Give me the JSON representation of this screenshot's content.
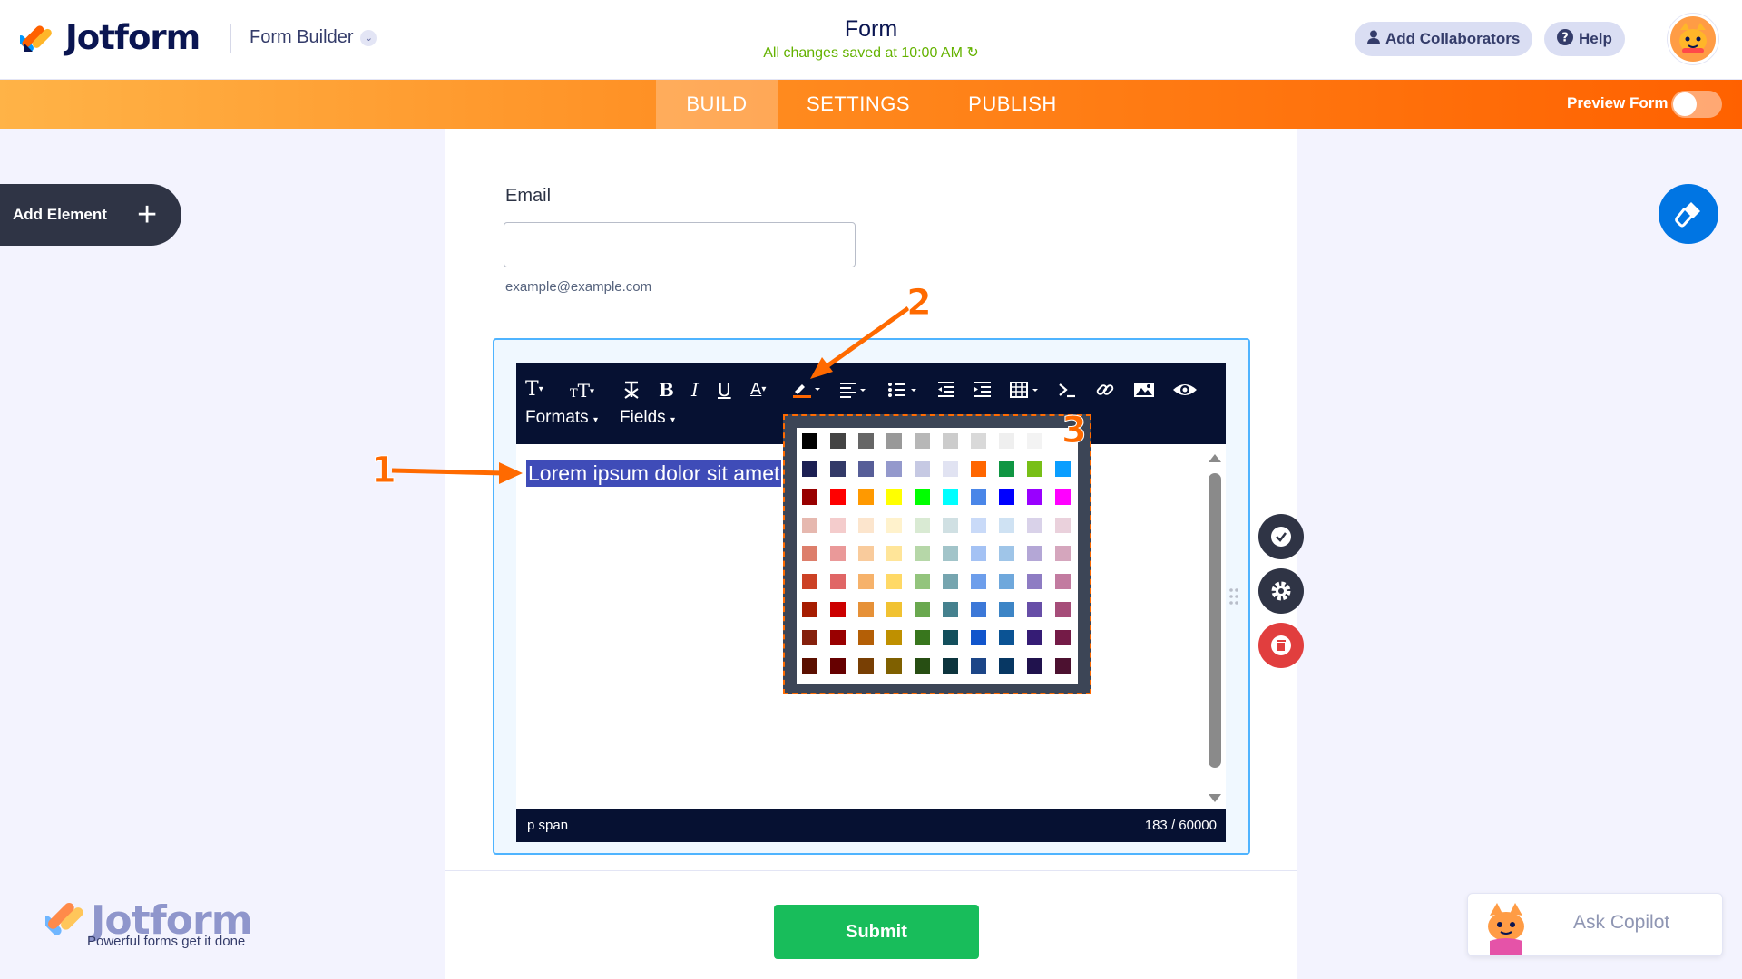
{
  "header": {
    "logo_text": "Jotform",
    "builder_label": "Form Builder",
    "form_title": "Form",
    "saved_status": "All changes saved at 10:00 AM",
    "collaborators_label": "Add Collaborators",
    "help_label": "Help"
  },
  "nav": {
    "tabs": [
      {
        "label": "BUILD",
        "active": true
      },
      {
        "label": "SETTINGS",
        "active": false
      },
      {
        "label": "PUBLISH",
        "active": false
      }
    ],
    "preview_label": "Preview Form",
    "preview_on": false
  },
  "sidebar": {
    "add_element_label": "Add Element"
  },
  "form": {
    "email_label": "Email",
    "email_value": "",
    "email_sublabel": "example@example.com",
    "editor": {
      "toolbar": {
        "formats_label": "Formats",
        "fields_label": "Fields"
      },
      "selected_text": "Lorem ipsum dolor sit amet",
      "path_label": "p  span",
      "char_count": "183 / 60000"
    },
    "submit_label": "Submit"
  },
  "palette": {
    "colors": [
      [
        "#000000",
        "#444444",
        "#666666",
        "#999999",
        "#b7b7b7",
        "#cccccc",
        "#d9d9d9",
        "#efefef",
        "#f3f3f3",
        "#ffffff"
      ],
      [
        "#1c2053",
        "#333a68",
        "#575e98",
        "#9499cc",
        "#c6c9e3",
        "#e1e3f2",
        "#ff6600",
        "#109643",
        "#78bf17",
        "#0a9eff"
      ],
      [
        "#980000",
        "#ff0000",
        "#ff9900",
        "#ffff00",
        "#00ff00",
        "#00ffff",
        "#4a86e8",
        "#0000ff",
        "#9900ff",
        "#ff00ff"
      ],
      [
        "#e6b8af",
        "#f4cccc",
        "#fce5cd",
        "#fff2cc",
        "#d9ead3",
        "#d0e0e3",
        "#c9daf8",
        "#cfe2f3",
        "#d9d2e9",
        "#ead1dc"
      ],
      [
        "#dd7e6b",
        "#ea9999",
        "#f9cb9c",
        "#ffe599",
        "#b6d7a8",
        "#a2c4c9",
        "#a4c2f4",
        "#9fc5e8",
        "#b4a7d6",
        "#d5a6bd"
      ],
      [
        "#cc4125",
        "#e06666",
        "#f6b26b",
        "#ffd966",
        "#93c47d",
        "#76a5af",
        "#6d9eeb",
        "#6fa8dc",
        "#8e7cc3",
        "#c27ba0"
      ],
      [
        "#a61c00",
        "#cc0000",
        "#e69138",
        "#f1c232",
        "#6aa84f",
        "#45818e",
        "#3c78d8",
        "#3d85c6",
        "#674ea7",
        "#a64d79"
      ],
      [
        "#85200c",
        "#990000",
        "#b45f06",
        "#bf9000",
        "#38761d",
        "#134f5c",
        "#1155cc",
        "#0b5394",
        "#351c75",
        "#741b47"
      ],
      [
        "#5b0f00",
        "#660000",
        "#783f04",
        "#7f6000",
        "#274e13",
        "#0c343d",
        "#1c4587",
        "#073763",
        "#20124d",
        "#4c1130"
      ]
    ]
  },
  "annotations": [
    "1",
    "2",
    "3"
  ],
  "watermark": {
    "text": "Jotform",
    "tagline": "Powerful forms get it done"
  },
  "copilot": {
    "label": "Ask Copilot"
  },
  "colors": {
    "accent": "#ff6100",
    "submit": "#18bd5b",
    "toolbar": "#061132",
    "selection": "#3f4cb8"
  }
}
